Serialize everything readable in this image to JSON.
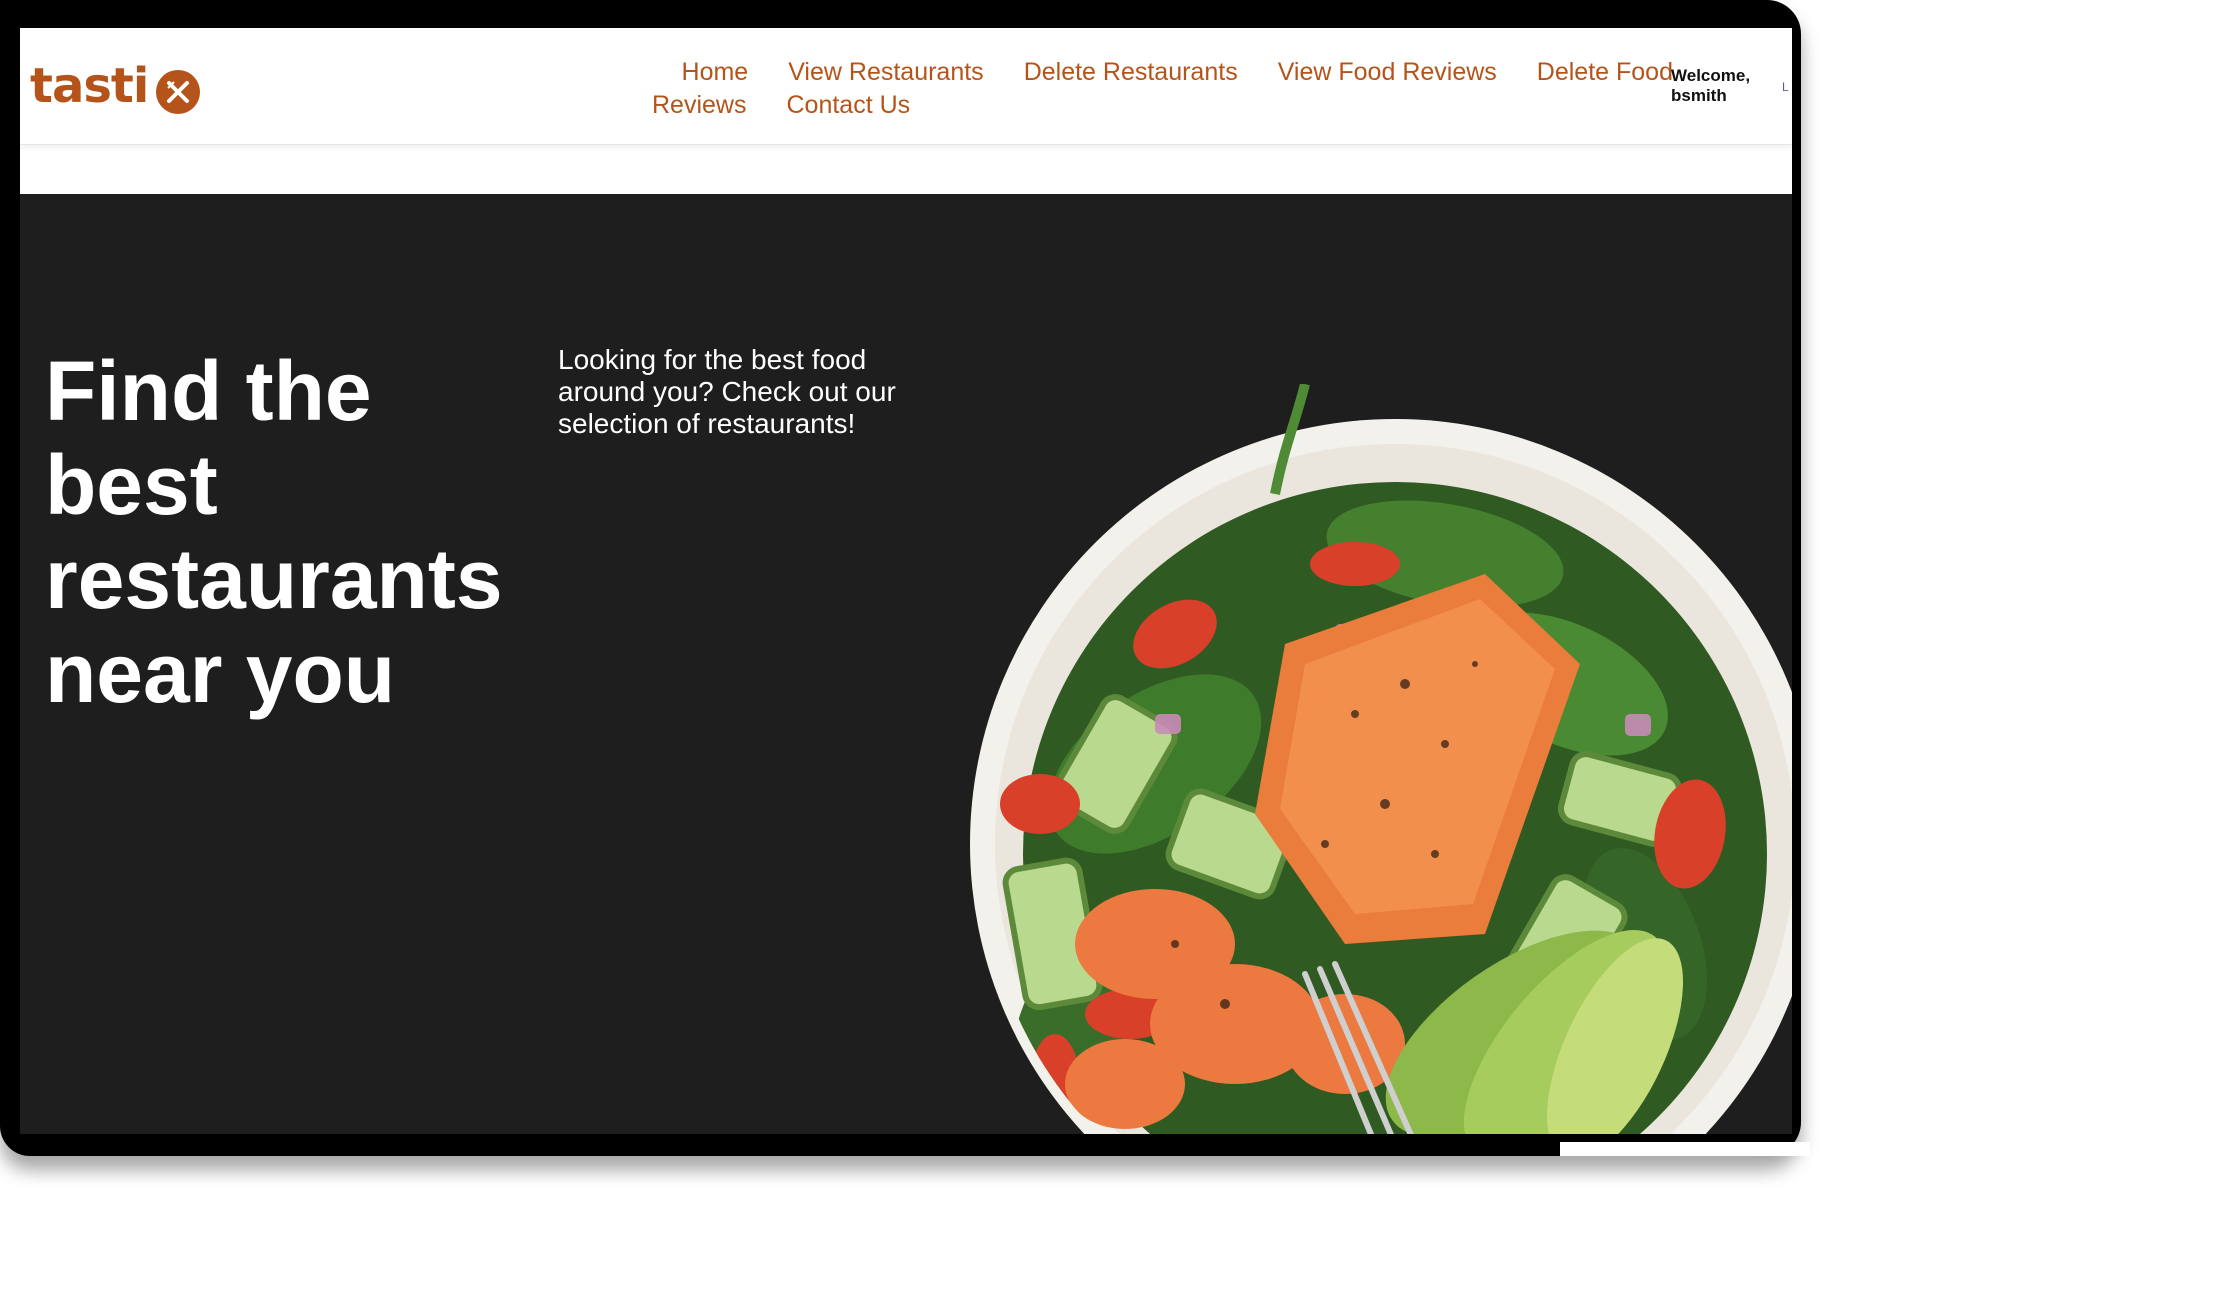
{
  "brand": {
    "name": "tasti",
    "icon": "fork-knife-icon",
    "color": "#b5541a"
  },
  "nav": {
    "links": [
      "Home",
      "View Restaurants",
      "Delete Restaurants",
      "View Food Reviews",
      "Delete Food",
      "Reviews",
      "Contact Us"
    ],
    "link_color": "#b5541a"
  },
  "user": {
    "welcome": "Welcome,",
    "username": "bsmith"
  },
  "hero": {
    "title": "Find the best restaurants near you",
    "subtitle": "Looking for the best food around you? Check out our selection of restaurants!",
    "background": "#1e1e1e",
    "image": "salmon-salad-bowl"
  }
}
